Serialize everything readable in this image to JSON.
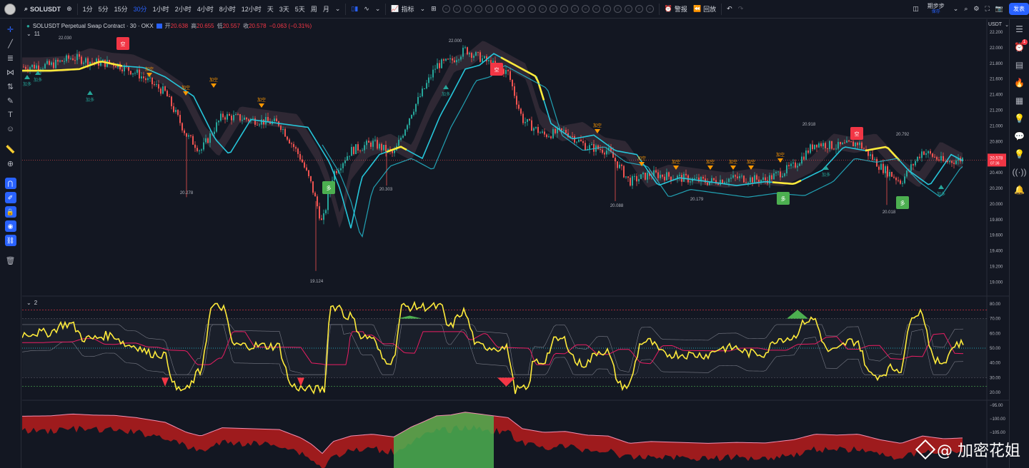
{
  "toolbar": {
    "symbol": "SOLUSDT",
    "timeframes": [
      "1分",
      "5分",
      "15分",
      "30分",
      "1小时",
      "2小时",
      "4小时",
      "8小时",
      "12小时",
      "天",
      "3天",
      "5天",
      "周",
      "月"
    ],
    "active_timeframe": "30分",
    "indicators_label": "指标",
    "circle_tools": [
      "○",
      "○",
      "○",
      "○",
      "○",
      "○",
      "○",
      "○",
      "○",
      "○",
      "○",
      "○",
      "○",
      "○",
      "○",
      "○",
      "○",
      "○",
      "○",
      "○"
    ],
    "alert_label": "警报",
    "replay_label": "回放",
    "account_label": "期步步",
    "account_sub": "保存",
    "publish_label": "发表"
  },
  "legend": {
    "title": "SOLUSDT Perpetual Swap Contract · 30 · OKX",
    "open_label": "开",
    "open": "20.638",
    "high_label": "高",
    "high": "20.655",
    "low_label": "低",
    "low": "20.557",
    "close_label": "收",
    "close": "20.578",
    "change": "−0.063 (−0.31%)"
  },
  "panels": {
    "main_tag": "11",
    "rsi_tag": "2"
  },
  "price_axis": {
    "currency": "USDT",
    "ticks": [
      "22.200",
      "22.000",
      "21.800",
      "21.600",
      "21.400",
      "21.200",
      "21.000",
      "20.800",
      "20.600",
      "20.400",
      "20.200",
      "20.000",
      "19.800",
      "19.600",
      "19.400",
      "19.200",
      "19.000"
    ],
    "last_price": "20.578",
    "last_price_sub": "07:36"
  },
  "rsi_axis": {
    "ticks": [
      "80.00",
      "70.00",
      "60.00",
      "50.00",
      "40.00",
      "30.00",
      "20.00"
    ]
  },
  "osc_axis": {
    "ticks": [
      "−95.00",
      "−100.00",
      "−105.00"
    ]
  },
  "annotations": {
    "highs": [
      {
        "label": "22.030"
      },
      {
        "label": "22.000"
      },
      {
        "label": "20.918"
      },
      {
        "label": "20.792"
      }
    ],
    "lows": [
      {
        "label": "20.278"
      },
      {
        "label": "19.124"
      },
      {
        "label": "20.303"
      },
      {
        "label": "20.088"
      },
      {
        "label": "20.179"
      },
      {
        "label": "20.018"
      }
    ],
    "short_signal_label": "空",
    "long_signal_label": "多",
    "add_short_label": "加空",
    "add_long_label": "加多"
  },
  "colors": {
    "bg": "#131722",
    "up": "#26a69a",
    "down": "#ef5350",
    "accent": "#2962ff",
    "ema": "#26c6da",
    "highlight": "#ffeb3b"
  },
  "watermark": "@ 加密花姐"
}
